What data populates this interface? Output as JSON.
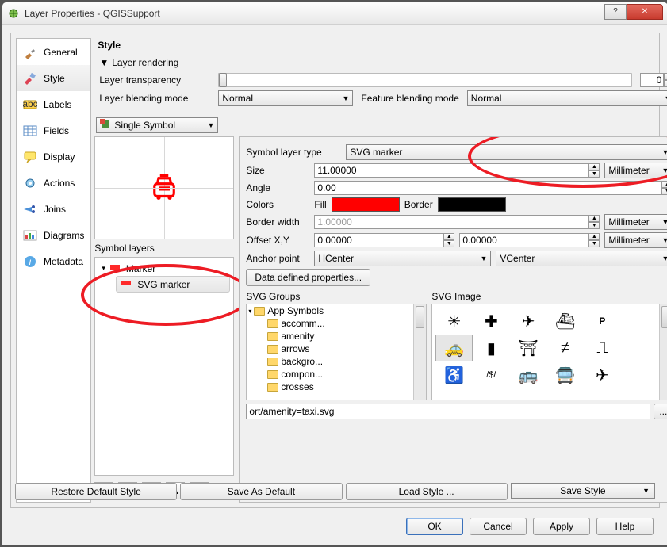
{
  "window": {
    "title": "Layer Properties - QGISSupport"
  },
  "sidebar": {
    "items": [
      {
        "label": "General"
      },
      {
        "label": "Style"
      },
      {
        "label": "Labels"
      },
      {
        "label": "Fields"
      },
      {
        "label": "Display"
      },
      {
        "label": "Actions"
      },
      {
        "label": "Joins"
      },
      {
        "label": "Diagrams"
      },
      {
        "label": "Metadata"
      }
    ]
  },
  "style": {
    "title": "Style",
    "rendering_label": "Layer rendering",
    "transparency_label": "Layer transparency",
    "transparency_value": "0",
    "layer_blend_label": "Layer blending mode",
    "layer_blend_value": "Normal",
    "feature_blend_label": "Feature blending mode",
    "feature_blend_value": "Normal",
    "renderer_value": "Single Symbol",
    "symlayers_label": "Symbol layers",
    "tree": {
      "root": "Marker",
      "child": "SVG marker"
    }
  },
  "props": {
    "type_label": "Symbol layer type",
    "type_value": "SVG marker",
    "size_label": "Size",
    "size_value": "11.00000",
    "size_unit": "Millimeter",
    "angle_label": "Angle",
    "angle_value": "0.00",
    "colors_label": "Colors",
    "fill_label": "Fill",
    "fill_color": "#ff0000",
    "border_label": "Border",
    "border_color": "#000000",
    "borderw_label": "Border width",
    "borderw_value": "1.00000",
    "borderw_unit": "Millimeter",
    "offset_label": "Offset X,Y",
    "offset_x": "0.00000",
    "offset_y": "0.00000",
    "offset_unit": "Millimeter",
    "anchor_label": "Anchor point",
    "anchor_h": "HCenter",
    "anchor_v": "VCenter",
    "ddp_label": "Data defined properties...",
    "svg_groups_label": "SVG Groups",
    "svg_image_label": "SVG Image",
    "groups": [
      "App Symbols",
      "accomm...",
      "amenity",
      "arrows",
      "backgro...",
      "compon...",
      "crosses"
    ],
    "path_value": "ort/amenity=taxi.svg"
  },
  "footer": {
    "restore": "Restore Default Style",
    "save_default": "Save As Default",
    "load": "Load Style ...",
    "save": "Save Style"
  },
  "dialog": {
    "ok": "OK",
    "cancel": "Cancel",
    "apply": "Apply",
    "help": "Help"
  }
}
